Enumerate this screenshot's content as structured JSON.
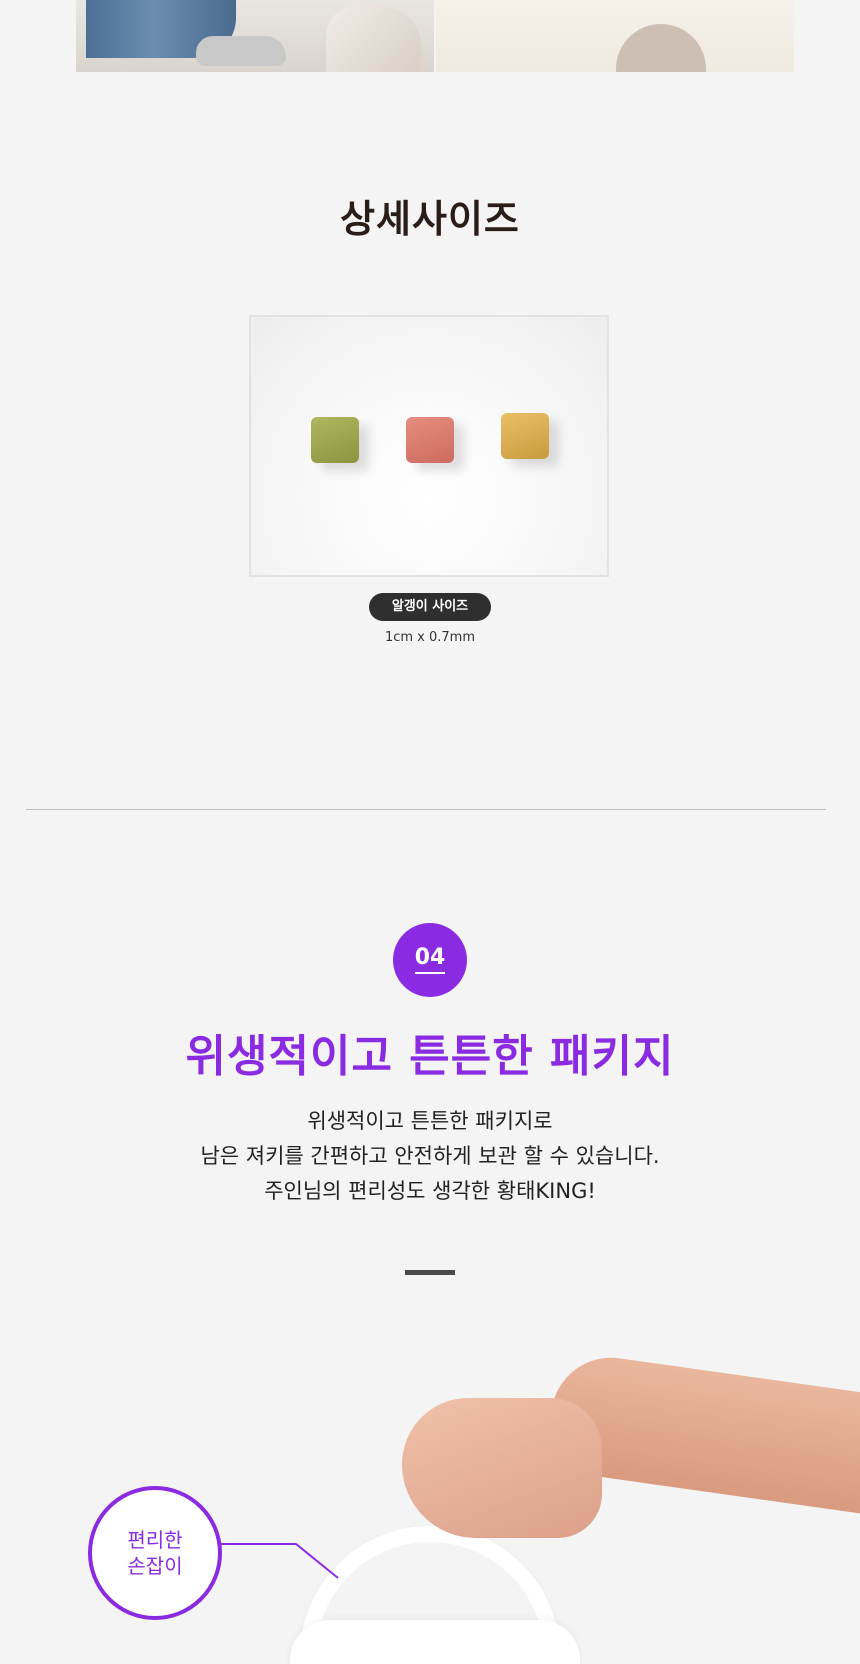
{
  "detail_size": {
    "title": "상세사이즈",
    "badge": "알갱이 사이즈",
    "value": "1cm x 0.7mm"
  },
  "section4": {
    "number": "04",
    "headline": "위생적이고 튼튼한 패키지",
    "desc_lines": [
      "위생적이고 튼튼한 패키지로",
      "남은 져키를 간편하고 안전하게 보관 할 수 있습니다.",
      "주인님의 편리성도 생각한 황태KING!"
    ],
    "callout_lines": [
      "편리한",
      "손잡이"
    ]
  },
  "colors": {
    "accent": "#8a2be2",
    "title": "#2a1c16",
    "badge_bg": "#2f2f2f",
    "background": "#f4f4f4"
  }
}
